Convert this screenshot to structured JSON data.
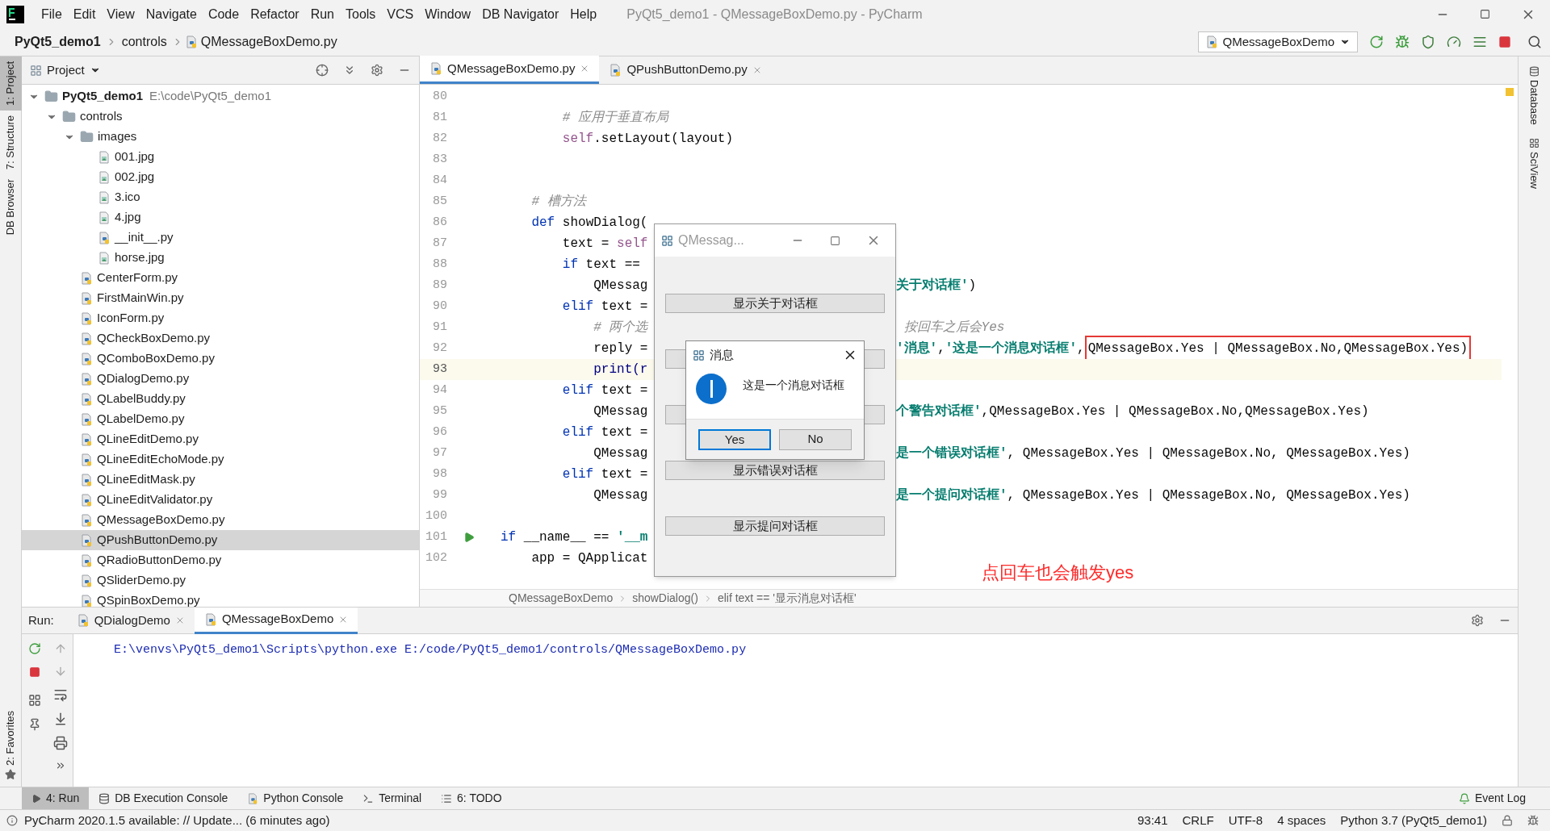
{
  "title_bar": {
    "menu": [
      "File",
      "Edit",
      "View",
      "Navigate",
      "Code",
      "Refactor",
      "Run",
      "Tools",
      "VCS",
      "Window",
      "DB Navigator",
      "Help"
    ],
    "title": "PyQt5_demo1 - QMessageBoxDemo.py - PyCharm"
  },
  "nav_bar": {
    "crumbs": [
      "PyQt5_demo1",
      "controls",
      "QMessageBoxDemo.py"
    ],
    "run_config": "QMessageBoxDemo"
  },
  "left_tool_tabs": [
    {
      "label": "1: Project",
      "selected": true
    },
    {
      "label": "7: Structure",
      "selected": false
    },
    {
      "label": "DB Browser",
      "selected": false
    }
  ],
  "favorites_tab": "2: Favorites",
  "project_panel": {
    "title": "Project",
    "tree": [
      {
        "name": "PyQt5_demo1",
        "path": "E:\\code\\PyQt5_demo1",
        "kind": "folder",
        "expanded": true,
        "selected": false,
        "children": [
          {
            "name": "controls",
            "kind": "folder",
            "expanded": true,
            "selected": false,
            "children": [
              {
                "name": "images",
                "kind": "folder",
                "expanded": true,
                "selected": false,
                "children": [
                  {
                    "name": "001.jpg",
                    "kind": "image",
                    "selected": false
                  },
                  {
                    "name": "002.jpg",
                    "kind": "image",
                    "selected": false
                  },
                  {
                    "name": "3.ico",
                    "kind": "image",
                    "selected": false
                  },
                  {
                    "name": "4.jpg",
                    "kind": "image",
                    "selected": false
                  },
                  {
                    "name": "__init__.py",
                    "kind": "python",
                    "selected": false
                  },
                  {
                    "name": "horse.jpg",
                    "kind": "image",
                    "selected": false
                  }
                ]
              },
              {
                "name": "CenterForm.py",
                "kind": "python",
                "selected": false
              },
              {
                "name": "FirstMainWin.py",
                "kind": "python",
                "selected": false
              },
              {
                "name": "IconForm.py",
                "kind": "python",
                "selected": false
              },
              {
                "name": "QCheckBoxDemo.py",
                "kind": "python",
                "selected": false
              },
              {
                "name": "QComboBoxDemo.py",
                "kind": "python",
                "selected": false
              },
              {
                "name": "QDialogDemo.py",
                "kind": "python",
                "selected": false
              },
              {
                "name": "QLabelBuddy.py",
                "kind": "python",
                "selected": false
              },
              {
                "name": "QLabelDemo.py",
                "kind": "python",
                "selected": false
              },
              {
                "name": "QLineEditDemo.py",
                "kind": "python",
                "selected": false
              },
              {
                "name": "QLineEditEchoMode.py",
                "kind": "python",
                "selected": false
              },
              {
                "name": "QLineEditMask.py",
                "kind": "python",
                "selected": false
              },
              {
                "name": "QLineEditValidator.py",
                "kind": "python",
                "selected": false
              },
              {
                "name": "QMessageBoxDemo.py",
                "kind": "python",
                "selected": false
              },
              {
                "name": "QPushButtonDemo.py",
                "kind": "python",
                "selected": true
              },
              {
                "name": "QRadioButtonDemo.py",
                "kind": "python",
                "selected": false
              },
              {
                "name": "QSliderDemo.py",
                "kind": "python",
                "selected": false
              },
              {
                "name": "QSpinBoxDemo.py",
                "kind": "python",
                "selected": false
              }
            ]
          }
        ]
      }
    ]
  },
  "editor": {
    "tabs": [
      {
        "label": "QMessageBoxDemo.py",
        "selected": true
      },
      {
        "label": "QPushButtonDemo.py",
        "selected": false
      }
    ],
    "lines": [
      {
        "number": "80",
        "current": false,
        "runnable": false
      },
      {
        "number": "81",
        "current": false,
        "runnable": false,
        "left": [
          {
            "text": "        # 应用于垂直布局",
            "kind": "comment"
          }
        ]
      },
      {
        "number": "82",
        "current": false,
        "runnable": false,
        "left": [
          {
            "text": "        self",
            "kind": "self"
          },
          {
            "text": ".setLayout(layout)",
            "kind": "code"
          }
        ]
      },
      {
        "number": "83",
        "current": false,
        "runnable": false
      },
      {
        "number": "84",
        "current": false,
        "runnable": false
      },
      {
        "number": "85",
        "current": false,
        "runnable": false,
        "left": [
          {
            "text": "    # 槽方法",
            "kind": "comment"
          }
        ]
      },
      {
        "number": "86",
        "current": false,
        "runnable": false,
        "left": [
          {
            "text": "    def",
            "kind": "keyword"
          },
          {
            "text": " showDialog(",
            "kind": "code"
          }
        ]
      },
      {
        "number": "87",
        "current": false,
        "runnable": false,
        "left": [
          {
            "text": "        text = ",
            "kind": "code"
          },
          {
            "text": "self",
            "kind": "self"
          }
        ]
      },
      {
        "number": "88",
        "current": false,
        "runnable": false,
        "left": [
          {
            "text": "        if",
            "kind": "keyword"
          },
          {
            "text": " text ==",
            "kind": "code"
          }
        ]
      },
      {
        "number": "89",
        "current": false,
        "runnable": false,
        "left": [
          {
            "text": "            QMessag",
            "kind": "code"
          }
        ],
        "right": [
          {
            "text": "关于对话框'",
            "kind": "string"
          },
          {
            "text": ")",
            "kind": "code"
          }
        ]
      },
      {
        "number": "90",
        "current": false,
        "runnable": false,
        "left": [
          {
            "text": "        elif",
            "kind": "keyword"
          },
          {
            "text": " text =",
            "kind": "code"
          }
        ]
      },
      {
        "number": "91",
        "current": false,
        "runnable": false,
        "left": [
          {
            "text": "            # 两个选",
            "kind": "comment"
          }
        ],
        "right": [
          {
            "text": " 按回车之后会Yes",
            "kind": "comment"
          }
        ]
      },
      {
        "number": "92",
        "current": false,
        "runnable": false,
        "left": [
          {
            "text": "            reply =",
            "kind": "code"
          }
        ],
        "right": [
          {
            "text": "'消息'",
            "kind": "string"
          },
          {
            "text": ",",
            "kind": "code"
          },
          {
            "text": "'这是一个消息对话框'",
            "kind": "string"
          },
          {
            "text": ",",
            "kind": "code"
          },
          {
            "text": "QMessageBox.Yes | QMessageBox.No,QMessageBox.Yes)",
            "kind": "boxed"
          }
        ]
      },
      {
        "number": "93",
        "current": true,
        "runnable": false,
        "left": [
          {
            "text": "            print(r",
            "kind": "builtin"
          }
        ]
      },
      {
        "number": "94",
        "current": false,
        "runnable": false,
        "left": [
          {
            "text": "        elif",
            "kind": "keyword"
          },
          {
            "text": " text =",
            "kind": "code"
          }
        ]
      },
      {
        "number": "95",
        "current": false,
        "runnable": false,
        "left": [
          {
            "text": "            QMessag",
            "kind": "code"
          }
        ],
        "right": [
          {
            "text": "个警告对话框'",
            "kind": "string"
          },
          {
            "text": ",QMessageBox.Yes | QMessageBox.No,QMessageBox.Yes)",
            "kind": "code"
          }
        ]
      },
      {
        "number": "96",
        "current": false,
        "runnable": false,
        "left": [
          {
            "text": "        elif",
            "kind": "keyword"
          },
          {
            "text": " text =",
            "kind": "code"
          }
        ]
      },
      {
        "number": "97",
        "current": false,
        "runnable": false,
        "left": [
          {
            "text": "            QMessag",
            "kind": "code"
          }
        ],
        "right": [
          {
            "text": "是一个错误对话框'",
            "kind": "string"
          },
          {
            "text": ", QMessageBox.Yes | QMessageBox.No, QMessageBox.Yes)",
            "kind": "code"
          }
        ]
      },
      {
        "number": "98",
        "current": false,
        "runnable": false,
        "left": [
          {
            "text": "        elif",
            "kind": "keyword"
          },
          {
            "text": " text =",
            "kind": "code"
          }
        ]
      },
      {
        "number": "99",
        "current": false,
        "runnable": false,
        "left": [
          {
            "text": "            QMessag",
            "kind": "code"
          }
        ],
        "right": [
          {
            "text": "是一个提问对话框'",
            "kind": "string"
          },
          {
            "text": ", QMessageBox.Yes | QMessageBox.No, QMessageBox.Yes)",
            "kind": "code"
          }
        ]
      },
      {
        "number": "100",
        "current": false,
        "runnable": false
      },
      {
        "number": "101",
        "current": false,
        "runnable": true,
        "left": [
          {
            "text": "if",
            "kind": "keyword"
          },
          {
            "text": " __name__ == ",
            "kind": "code"
          },
          {
            "text": "'__m",
            "kind": "string"
          }
        ]
      },
      {
        "number": "102",
        "current": false,
        "runnable": false,
        "left": [
          {
            "text": "    app = QApplicat",
            "kind": "code"
          }
        ]
      }
    ],
    "breadcrumbs": [
      "QMessageBoxDemo",
      "showDialog()",
      "elif text == '显示消息对话框'"
    ],
    "annotation": "点回车也会触发yes"
  },
  "app_window": {
    "title": "QMessag...",
    "buttons": [
      {
        "kind": "labeled",
        "label": "显示关于对话框"
      },
      {
        "kind": "blank"
      },
      {
        "kind": "blank"
      },
      {
        "kind": "labeled",
        "label": "显示错误对话框"
      },
      {
        "kind": "labeled",
        "label": "显示提问对话框"
      }
    ]
  },
  "message_box": {
    "title": "消息",
    "text": "这是一个消息对话框",
    "buttons": [
      {
        "label": "Yes",
        "selected": true
      },
      {
        "label": "No",
        "selected": false
      }
    ]
  },
  "right_tool_tabs": [
    "Database",
    "SciView"
  ],
  "run_panel": {
    "label": "Run:",
    "tabs": [
      {
        "label": "QDialogDemo",
        "selected": false
      },
      {
        "label": "QMessageBoxDemo",
        "selected": true
      }
    ],
    "output": "E:\\venvs\\PyQt5_demo1\\Scripts\\python.exe E:/code/PyQt5_demo1/controls/QMessageBoxDemo.py"
  },
  "bottom_tools": [
    {
      "label": "4: Run",
      "kind": "run",
      "selected": true
    },
    {
      "label": "DB Execution Console",
      "kind": "database",
      "selected": false
    },
    {
      "label": "Python Console",
      "kind": "python",
      "selected": false
    },
    {
      "label": "Terminal",
      "kind": "terminal",
      "selected": false
    },
    {
      "label": "6: TODO",
      "kind": "list",
      "selected": false
    }
  ],
  "event_log": "Event Log",
  "status_bar": {
    "message": "PyCharm 2020.1.5 available: // Update... (6 minutes ago)",
    "items": [
      "93:41",
      "CRLF",
      "UTF-8",
      "4 spaces",
      "Python 3.7 (PyQt5_demo1)"
    ]
  }
}
